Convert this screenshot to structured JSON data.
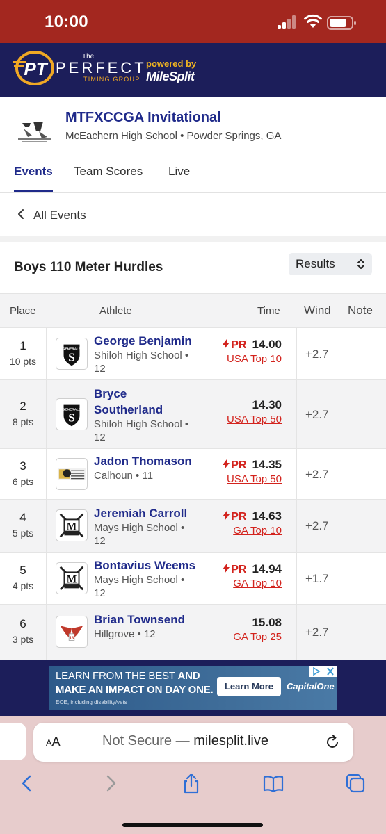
{
  "status_bar": {
    "time": "10:00"
  },
  "brand": {
    "logo_text": "PT",
    "the": "The",
    "name": "PERFECT",
    "sub": "TIMING GROUP",
    "powered_by": "powered by",
    "partner": "MileSplit"
  },
  "meet": {
    "title": "MTFXCCGA Invitational",
    "location": "McEachern High School • Powder Springs, GA"
  },
  "tabs": [
    {
      "label": "Events",
      "active": true
    },
    {
      "label": "Team Scores",
      "active": false
    },
    {
      "label": "Live",
      "active": false
    }
  ],
  "nav": {
    "back_label": "All Events"
  },
  "event": {
    "title": "Boys 110 Meter Hurdles",
    "view_select": "Results"
  },
  "table": {
    "headers": {
      "place": "Place",
      "athlete": "Athlete",
      "time": "Time",
      "wind": "Wind",
      "note": "Note"
    },
    "rows": [
      {
        "place": "1",
        "pts": "10 pts",
        "name": "George Benjamin",
        "school": "Shiloh High School • 12",
        "pr": "PR",
        "time": "14.00",
        "rank": "USA Top 10",
        "wind": "+2.7",
        "logo": "shiloh"
      },
      {
        "place": "2",
        "pts": "8 pts",
        "name": "Bryce Southerland",
        "school": "Shiloh High School • 12",
        "pr": "",
        "time": "14.30",
        "rank": "USA Top 50",
        "wind": "+2.7",
        "logo": "shiloh"
      },
      {
        "place": "3",
        "pts": "6 pts",
        "name": "Jadon Thomason",
        "school": "Calhoun • 11",
        "pr": "PR",
        "time": "14.35",
        "rank": "USA Top 50",
        "wind": "+2.7",
        "logo": "calhoun"
      },
      {
        "place": "4",
        "pts": "5 pts",
        "name": "Jeremiah Carroll",
        "school": "Mays High School • 12",
        "pr": "PR",
        "time": "14.63",
        "rank": "GA Top 10",
        "wind": "+2.7",
        "logo": "mays"
      },
      {
        "place": "5",
        "pts": "4 pts",
        "name": "Bontavius Weems",
        "school": "Mays High School • 12",
        "pr": "PR",
        "time": "14.94",
        "rank": "GA Top 10",
        "wind": "+1.7",
        "logo": "mays"
      },
      {
        "place": "6",
        "pts": "3 pts",
        "name": "Brian Townsend",
        "school": "Hillgrove • 12",
        "pr": "",
        "time": "15.08",
        "rank": "GA Top 25",
        "wind": "+2.7",
        "logo": "hillgrove"
      }
    ]
  },
  "ad": {
    "line1_a": "LEARN FROM THE BEST",
    "line1_b": "AND",
    "line2": "MAKE AN IMPACT ON DAY ONE.",
    "line3": "EOE, including disability/vets",
    "cta": "Learn More",
    "brand": "CapitalOne"
  },
  "browser": {
    "aa": "AA",
    "security": "Not Secure",
    "separator": " — ",
    "url": "milesplit.live"
  },
  "colors": {
    "status_bar": "#a3271f",
    "header_bg": "#1c1e5a",
    "accent": "#1f2a8a",
    "pr_red": "#d3231d",
    "safari_bg": "#e7cccc"
  }
}
